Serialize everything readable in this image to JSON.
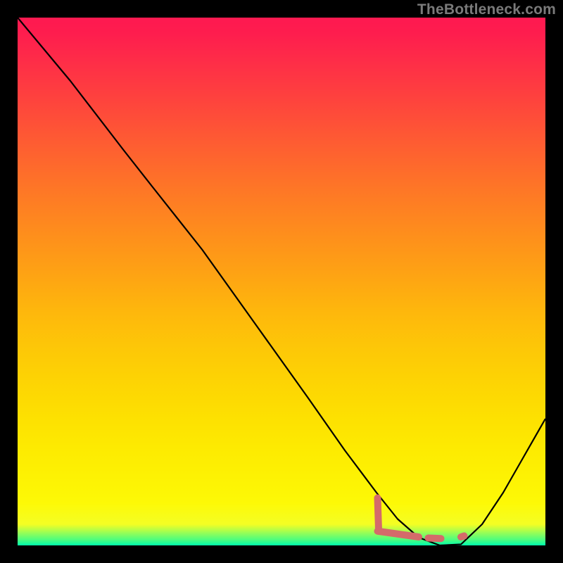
{
  "watermark": "TheBottleneck.com",
  "chart_data": {
    "type": "line",
    "title": "",
    "xlabel": "",
    "ylabel": "",
    "xlim": [
      0,
      100
    ],
    "ylim": [
      0,
      100
    ],
    "gradient_stops": [
      {
        "pct": 0,
        "color": "#fe1950"
      },
      {
        "pct": 3,
        "color": "#fe1d4e"
      },
      {
        "pct": 8,
        "color": "#fe2c48"
      },
      {
        "pct": 15,
        "color": "#fe413e"
      },
      {
        "pct": 23,
        "color": "#fe5a33"
      },
      {
        "pct": 32,
        "color": "#fe7527"
      },
      {
        "pct": 41,
        "color": "#fe8e1c"
      },
      {
        "pct": 49,
        "color": "#fea413"
      },
      {
        "pct": 56,
        "color": "#feb80c"
      },
      {
        "pct": 63,
        "color": "#fdc807"
      },
      {
        "pct": 70,
        "color": "#fdd603"
      },
      {
        "pct": 76,
        "color": "#fde101"
      },
      {
        "pct": 82,
        "color": "#fdeb01"
      },
      {
        "pct": 87,
        "color": "#fdf203"
      },
      {
        "pct": 92,
        "color": "#fdf906"
      },
      {
        "pct": 96,
        "color": "#f4fe24"
      },
      {
        "pct": 99,
        "color": "#48fd81"
      },
      {
        "pct": 100,
        "color": "#00fdae"
      }
    ],
    "series": [
      {
        "name": "bottleneck-curve",
        "color": "#000000",
        "width": 2.2,
        "points": [
          {
            "x": 0.0,
            "y": 100.0
          },
          {
            "x": 10.0,
            "y": 88.0
          },
          {
            "x": 20.0,
            "y": 75.0
          },
          {
            "x": 25.5,
            "y": 68.0
          },
          {
            "x": 35.0,
            "y": 56.0
          },
          {
            "x": 45.0,
            "y": 42.0
          },
          {
            "x": 55.0,
            "y": 28.0
          },
          {
            "x": 62.0,
            "y": 18.0
          },
          {
            "x": 68.0,
            "y": 10.0
          },
          {
            "x": 72.0,
            "y": 5.0
          },
          {
            "x": 76.0,
            "y": 1.5
          },
          {
            "x": 80.0,
            "y": 0.0
          },
          {
            "x": 84.0,
            "y": 0.2
          },
          {
            "x": 88.0,
            "y": 4.0
          },
          {
            "x": 92.0,
            "y": 10.0
          },
          {
            "x": 96.0,
            "y": 17.0
          },
          {
            "x": 100.0,
            "y": 24.0
          }
        ]
      }
    ],
    "highlight": {
      "color": "#d46a6a",
      "stroke_width": 10,
      "segments": [
        {
          "x1": 68.2,
          "y1": 9.0,
          "x2": 68.4,
          "y2": 3.0
        },
        {
          "x1": 68.2,
          "y1": 2.7,
          "x2": 76.0,
          "y2": 1.6
        },
        {
          "x1": 77.8,
          "y1": 1.4,
          "x2": 80.2,
          "y2": 1.3
        },
        {
          "x1": 84.0,
          "y1": 1.6,
          "x2": 84.6,
          "y2": 1.8
        }
      ]
    }
  }
}
